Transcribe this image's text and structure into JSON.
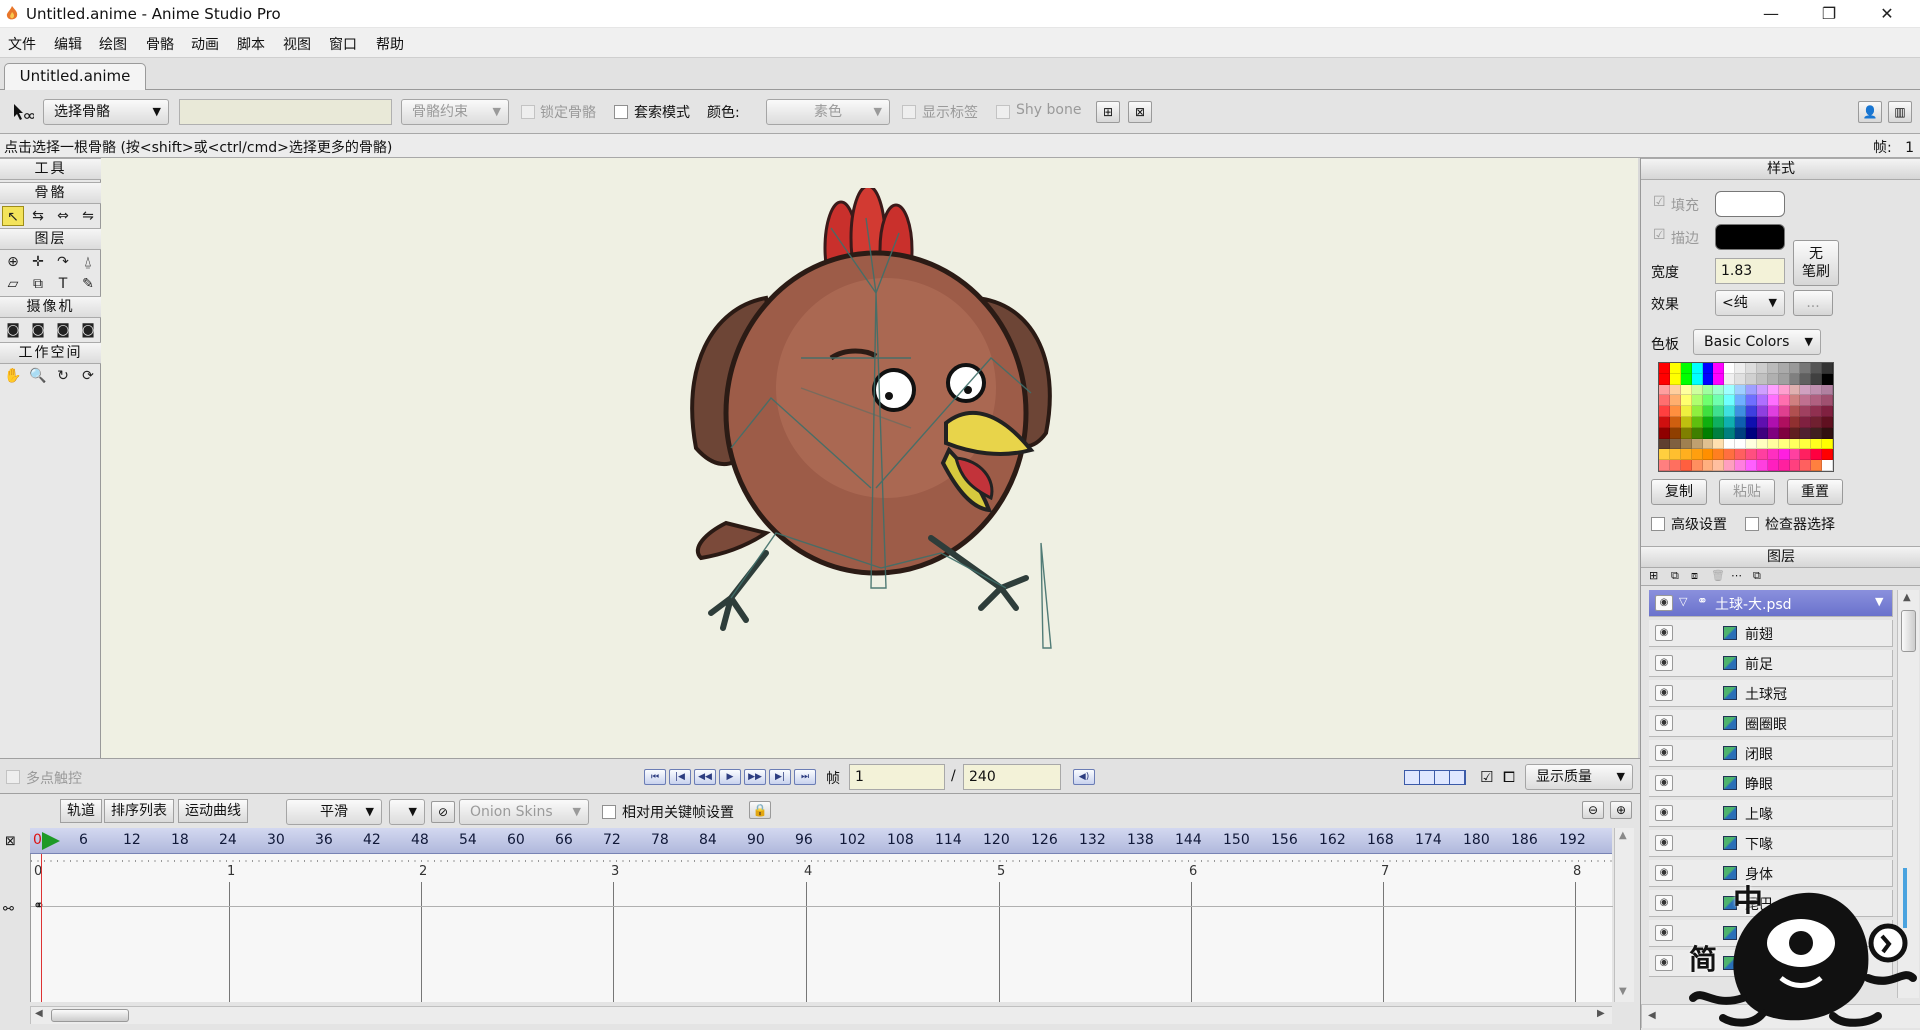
{
  "window": {
    "title": "Untitled.anime - Anime Studio Pro",
    "minimize": "—",
    "maximize": "❐",
    "close": "✕"
  },
  "menu": [
    "文件",
    "编辑",
    "绘图",
    "骨骼",
    "动画",
    "脚本",
    "视图",
    "窗口",
    "帮助"
  ],
  "doc_tab": "Untitled.anime",
  "toolbar": {
    "select_bone": "选择骨骼",
    "bone_name_value": "",
    "bone_constraint": "骨骼约束",
    "lock_bone": "锁定骨骼",
    "lasso_mode": "套索模式",
    "color_label": "颜色:",
    "color_value": "素色",
    "show_label": "显示标签",
    "shy_bone": "Shy bone"
  },
  "status": {
    "message": "点击选择一根骨骼 (按<shift>或<ctrl/cmd>选择更多的骨骼)",
    "frame_label": "帧:",
    "frame_value": "1"
  },
  "tools_panel": {
    "header": "工具",
    "sections": [
      "骨骼",
      "图层",
      "摄像机",
      "工作空间"
    ]
  },
  "playback": {
    "multitouch": "多点触控",
    "frame_label": "帧",
    "frame_value": "1",
    "separator": "/",
    "total_frames": "240",
    "display_quality": "显示质量"
  },
  "timeline": {
    "tabs": [
      "轨道",
      "排序列表",
      "运动曲线"
    ],
    "interpolation": "平滑",
    "onion_skins": "Onion Skins",
    "relative_keyframes": "相对用关键帧设置",
    "ruler_ticks": [
      "0",
      "6",
      "12",
      "18",
      "24",
      "30",
      "36",
      "42",
      "48",
      "54",
      "60",
      "66",
      "72",
      "78",
      "84",
      "90",
      "96",
      "102",
      "108",
      "114",
      "120",
      "126",
      "132",
      "138",
      "144",
      "150",
      "156",
      "162",
      "168",
      "174",
      "180",
      "186",
      "192"
    ],
    "seconds": [
      "0",
      "1",
      "2",
      "3",
      "4",
      "5",
      "6",
      "7",
      "8"
    ]
  },
  "style_panel": {
    "header": "样式",
    "fill_label": "填充",
    "stroke_label": "描边",
    "fill_color": "#ffffff",
    "stroke_color": "#000000",
    "no_brush": "无\n笔刷",
    "width_label": "宽度",
    "width_value": "1.83",
    "effect_label": "效果",
    "effect_value": "<纯",
    "effect_more": "...",
    "palette_label": "色板",
    "palette_value": "Basic Colors",
    "copy": "复制",
    "paste": "粘贴",
    "reset": "重置",
    "advanced": "高级设置",
    "inspector_select": "检查器选择"
  },
  "layers_panel": {
    "header": "图层",
    "group": "土球-大.psd",
    "layers": [
      "前翅",
      "前足",
      "土球冠",
      "圈圈眼",
      "闭眼",
      "睁眼",
      "上喙",
      "下喙",
      "身体",
      "尾巴",
      "",
      ""
    ]
  },
  "watermark_text": [
    "中",
    "简"
  ]
}
